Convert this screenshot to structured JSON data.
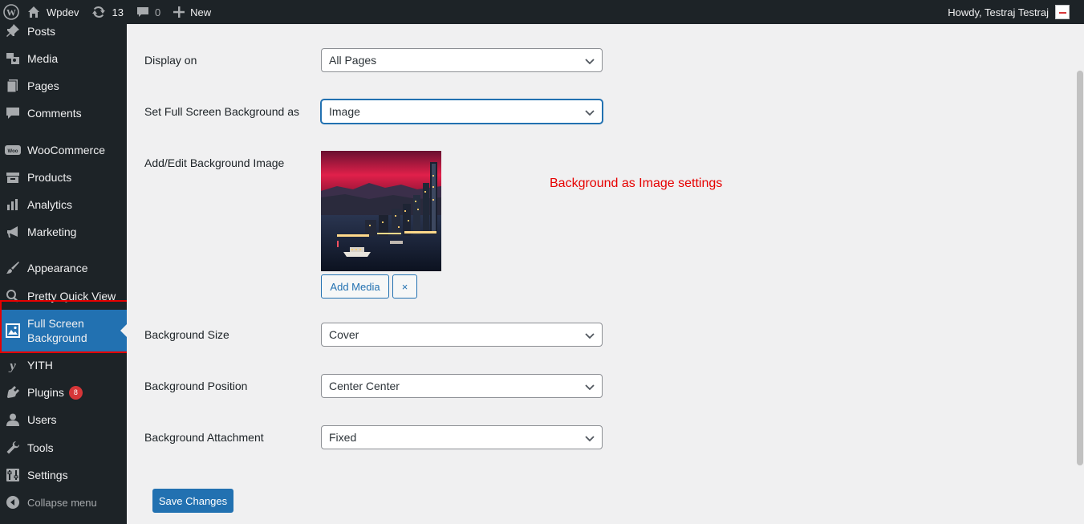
{
  "adminbar": {
    "site_name": "Wpdev",
    "updates_count": "13",
    "comments_count": "0",
    "new_label": "New",
    "greeting": "Howdy, Testraj Testraj"
  },
  "sidebar": {
    "items": [
      {
        "label": "Posts",
        "icon": "pin-icon"
      },
      {
        "label": "Media",
        "icon": "media-icon"
      },
      {
        "label": "Pages",
        "icon": "pages-icon"
      },
      {
        "label": "Comments",
        "icon": "comment-icon"
      },
      {
        "label": "WooCommerce",
        "icon": "woocommerce-icon"
      },
      {
        "label": "Products",
        "icon": "archive-icon"
      },
      {
        "label": "Analytics",
        "icon": "chart-bar-icon"
      },
      {
        "label": "Marketing",
        "icon": "megaphone-icon"
      },
      {
        "label": "Appearance",
        "icon": "brush-icon"
      },
      {
        "label": "Pretty Quick View",
        "icon": "search-icon"
      },
      {
        "label": "Full Screen Background",
        "icon": "image-icon",
        "current": true
      },
      {
        "label": "YITH",
        "icon": "yith-icon"
      },
      {
        "label": "Plugins",
        "icon": "plugin-icon",
        "badge": "8"
      },
      {
        "label": "Users",
        "icon": "user-icon"
      },
      {
        "label": "Tools",
        "icon": "wrench-icon"
      },
      {
        "label": "Settings",
        "icon": "settings-icon"
      },
      {
        "label": "Collapse menu",
        "icon": "collapse-icon"
      }
    ]
  },
  "form": {
    "display_on": {
      "label": "Display on",
      "value": "All Pages"
    },
    "bg_type": {
      "label": "Set Full Screen Background as",
      "value": "Image"
    },
    "bg_image": {
      "label": "Add/Edit Background Image",
      "add_media": "Add Media",
      "remove": "×"
    },
    "bg_size": {
      "label": "Background Size",
      "value": "Cover"
    },
    "bg_position": {
      "label": "Background Position",
      "value": "Center Center"
    },
    "bg_attachment": {
      "label": "Background Attachment",
      "value": "Fixed"
    },
    "annotation": "Background as Image settings",
    "save_label": "Save Changes"
  },
  "colors": {
    "adminbar_bg": "#1d2327",
    "accent": "#2271b1",
    "annotation": "#e60000",
    "badge": "#d63638"
  }
}
